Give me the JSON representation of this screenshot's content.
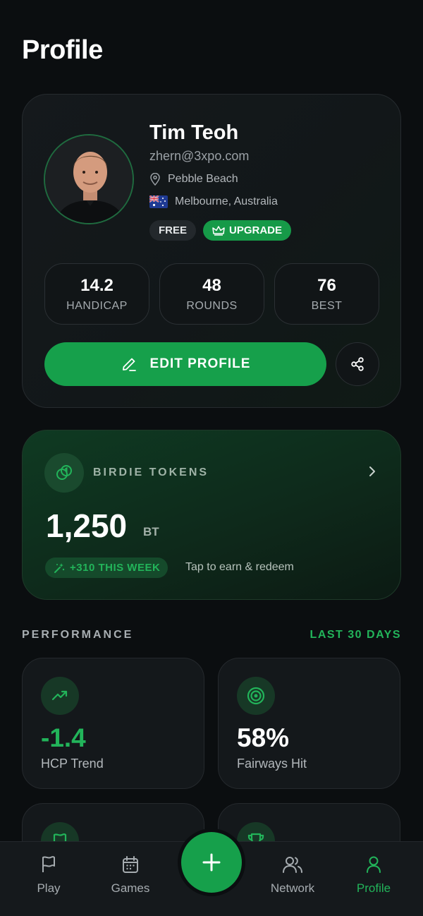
{
  "header": {
    "title": "Profile"
  },
  "profile": {
    "name": "Tim Teoh",
    "email": "zhern@3xpo.com",
    "home_course": "Pebble Beach",
    "location": "Melbourne, Australia",
    "plan_badge": "FREE",
    "upgrade_label": "UPGRADE",
    "stats": [
      {
        "value": "14.2",
        "label": "HANDICAP"
      },
      {
        "value": "48",
        "label": "ROUNDS"
      },
      {
        "value": "76",
        "label": "BEST"
      }
    ],
    "edit_label": "EDIT PROFILE"
  },
  "tokens": {
    "label": "BIRDIE TOKENS",
    "amount": "1,250",
    "unit": "BT",
    "week_gain": "+310 THIS WEEK",
    "cta": "Tap to earn & redeem"
  },
  "performance": {
    "title": "PERFORMANCE",
    "range": "LAST 30 DAYS",
    "cards": [
      {
        "value": "-1.4",
        "label": "HCP Trend",
        "icon": "trending-up-icon"
      },
      {
        "value": "58%",
        "label": "Fairways Hit",
        "icon": "target-icon"
      },
      {
        "value": "",
        "label": "",
        "icon": "flag-icon"
      },
      {
        "value": "",
        "label": "",
        "icon": "trophy-icon"
      }
    ]
  },
  "nav": {
    "items": [
      {
        "label": "Play",
        "icon": "flag-icon"
      },
      {
        "label": "Games",
        "icon": "calendar-icon"
      },
      {
        "label": "Network",
        "icon": "users-icon"
      },
      {
        "label": "Profile",
        "icon": "user-icon"
      }
    ],
    "add_icon": "plus-icon"
  },
  "colors": {
    "accent": "#16a04b",
    "accent_text": "#22b45a",
    "background": "#0b0e10",
    "card": "#14181b"
  }
}
